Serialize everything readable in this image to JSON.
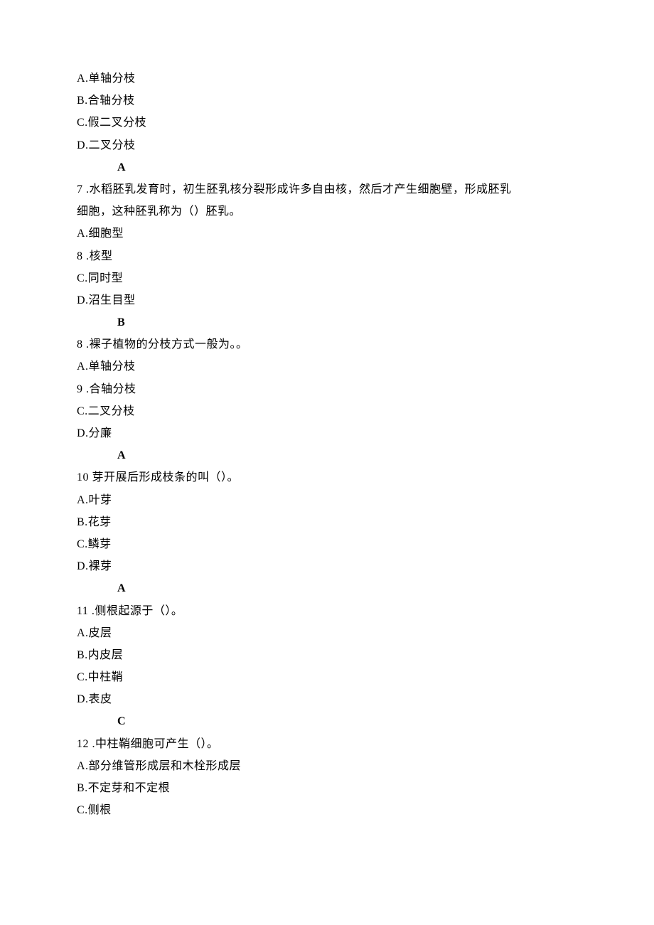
{
  "q6": {
    "optA": "A.单轴分枝",
    "optB": "B.合轴分枝",
    "optC": "C.假二叉分枝",
    "optD": "D.二叉分枝",
    "answer": "A"
  },
  "q7": {
    "stem1": "7 .水稻胚乳发育时，初生胚乳核分裂形成许多自由核，然后才产生细胞壁，形成胚乳",
    "stem2": "细胞，这种胚乳称为（）胚乳。",
    "optA": "A.细胞型",
    "optB": "8 .核型",
    "optC": "C.同时型",
    "optD": "D.沼生目型",
    "answer": "B"
  },
  "q8": {
    "stem": "8 .裸子植物的分枝方式一般为。。",
    "optA": "A.单轴分枝",
    "optB": "9 .合轴分枝",
    "optC": "C.二叉分枝",
    "optD": "D.分廉",
    "answer": "A"
  },
  "q10": {
    "stem": "10  芽开展后形成枝条的叫（）。",
    "optA": "A.叶芽",
    "optB": "B.花芽",
    "optC": "C.鳞芽",
    "optD": "D.裸芽",
    "answer": "A"
  },
  "q11": {
    "stem": "11 .侧根起源于（）。",
    "optA": "A.皮层",
    "optB": "B.内皮层",
    "optC": "C.中柱鞘",
    "optD": "D.表皮",
    "answer": "C"
  },
  "q12": {
    "stem": "12 .中柱鞘细胞可产生（）。",
    "optA": "A.部分维管形成层和木栓形成层",
    "optB": "B.不定芽和不定根",
    "optC": "C.侧根"
  }
}
